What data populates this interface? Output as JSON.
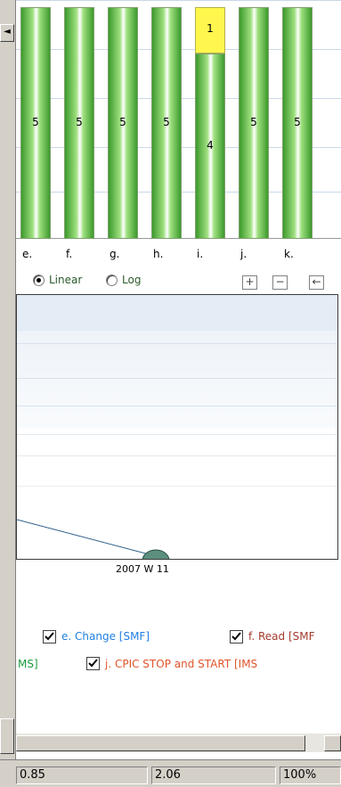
{
  "left_panel": {
    "scroll_arrow": "◄"
  },
  "bar_chart": {
    "chart_data": {
      "type": "bar",
      "categories": [
        "e.",
        "f.",
        "g.",
        "h.",
        "i.",
        "j.",
        "k."
      ],
      "series": [
        {
          "values": [
            5,
            5,
            5,
            5,
            4,
            5,
            5
          ]
        },
        {
          "values": [
            0,
            0,
            0,
            0,
            1,
            0,
            0
          ]
        }
      ],
      "data_labels": [
        "5",
        "5",
        "5",
        "5",
        "4",
        "5",
        "5"
      ],
      "stack_labels": [
        "",
        "",
        "",
        "",
        "1",
        "",
        ""
      ],
      "colors": [
        "#5cba3c",
        "#fff74d"
      ]
    }
  },
  "scale_options": {
    "linear_label": "Linear",
    "log_label": "Log",
    "selected": "Linear"
  },
  "zoom": {
    "in_icon": "+",
    "out_icon": "−",
    "back_icon": "←"
  },
  "line_chart": {
    "x_tick_label": "2007 W 11"
  },
  "legend": {
    "items": [
      {
        "label": "e. Change  [SMF]",
        "checked": true,
        "color": "#1f7fe0"
      },
      {
        "label": "f. Read [SMF",
        "checked": true,
        "color": "#a33a2e"
      },
      {
        "label": "MS]",
        "checked": false,
        "color": "#1a9b3a"
      },
      {
        "label": "j. CPIC STOP and START  [IMS",
        "checked": true,
        "color": "#e0542a"
      }
    ]
  },
  "statusbar": {
    "cells": [
      "0.85",
      "2.06",
      "100%"
    ]
  }
}
